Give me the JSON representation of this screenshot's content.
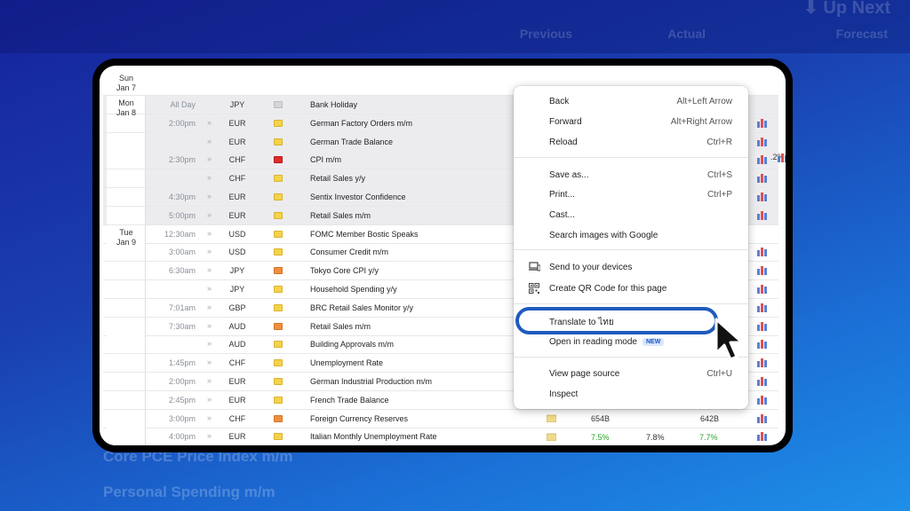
{
  "background": {
    "up_next": "⬇ Up Next",
    "col_prev": "Previous",
    "col_actual": "Actual",
    "col_forecast": "Forecast",
    "line1": "Core PCE Price Index m/m",
    "line2": "Personal Spending m/m"
  },
  "calendar": {
    "days": [
      {
        "name": "Sun",
        "date": "Jan 7"
      },
      {
        "name": "Mon",
        "date": "Jan 8"
      },
      {
        "name": "Tue",
        "date": "Jan 9"
      }
    ],
    "events": [
      {
        "time": "All Day",
        "currency": "JPY",
        "impact": "gray",
        "title": "Bank Holiday",
        "signal": false,
        "bars": false,
        "shaded": true
      },
      {
        "time": "2:00pm",
        "currency": "EUR",
        "impact": "yellow",
        "title": "German Factory Orders m/m",
        "signal": true,
        "bars": true,
        "shaded": true
      },
      {
        "time": "",
        "currency": "EUR",
        "impact": "yellow",
        "title": "German Trade Balance",
        "signal": true,
        "bars": true,
        "shaded": true
      },
      {
        "time": "2:30pm",
        "currency": "CHF",
        "impact": "red",
        "title": "CPI m/m",
        "signal": true,
        "bars": true,
        "shaded": true
      },
      {
        "time": "",
        "currency": "CHF",
        "impact": "yellow",
        "title": "Retail Sales y/y",
        "signal": true,
        "bars": true,
        "shaded": true
      },
      {
        "time": "4:30pm",
        "currency": "EUR",
        "impact": "yellow",
        "title": "Sentix Investor Confidence",
        "signal": true,
        "bars": true,
        "shaded": true
      },
      {
        "time": "5:00pm",
        "currency": "EUR",
        "impact": "yellow",
        "title": "Retail Sales m/m",
        "signal": true,
        "bars": true,
        "shaded": true
      },
      {
        "time": "12:30am",
        "currency": "USD",
        "impact": "yellow",
        "title": "FOMC Member Bostic Speaks",
        "signal": true,
        "bars": false,
        "shaded": false
      },
      {
        "time": "3:00am",
        "currency": "USD",
        "impact": "yellow",
        "title": "Consumer Credit m/m",
        "signal": true,
        "bars": true,
        "shaded": false
      },
      {
        "time": "6:30am",
        "currency": "JPY",
        "impact": "orange",
        "title": "Tokyo Core CPI y/y",
        "signal": true,
        "bars": true,
        "shaded": false
      },
      {
        "time": "",
        "currency": "JPY",
        "impact": "yellow",
        "title": "Household Spending y/y",
        "signal": true,
        "bars": true,
        "shaded": false
      },
      {
        "time": "7:01am",
        "currency": "GBP",
        "impact": "yellow",
        "title": "BRC Retail Sales Monitor y/y",
        "signal": true,
        "bars": true,
        "shaded": false
      },
      {
        "time": "7:30am",
        "currency": "AUD",
        "impact": "orange",
        "title": "Retail Sales m/m",
        "signal": true,
        "bars": true,
        "shaded": false
      },
      {
        "time": "",
        "currency": "AUD",
        "impact": "yellow",
        "title": "Building Approvals m/m",
        "signal": true,
        "bars": true,
        "shaded": false
      },
      {
        "time": "1:45pm",
        "currency": "CHF",
        "impact": "yellow",
        "title": "Unemployment Rate",
        "signal": true,
        "bars": true,
        "shaded": false
      },
      {
        "time": "2:00pm",
        "currency": "EUR",
        "impact": "yellow",
        "title": "German Industrial Production m/m",
        "signal": true,
        "bars": true,
        "shaded": false
      },
      {
        "time": "2:45pm",
        "currency": "EUR",
        "impact": "yellow",
        "title": "French Trade Balance",
        "signal": true,
        "bars": true,
        "shaded": false
      },
      {
        "time": "3:00pm",
        "currency": "CHF",
        "impact": "orange",
        "title": "Foreign Currency Reserves",
        "signal": true,
        "bars": true,
        "shaded": false
      },
      {
        "time": "4:00pm",
        "currency": "EUR",
        "impact": "yellow",
        "title": "Italian Monthly Unemployment Rate",
        "signal": true,
        "bars": true,
        "shaded": false
      }
    ],
    "cpi_previous_partial": ".2%",
    "reserves_actual": "654B",
    "reserves_previous": "642B",
    "unemp_actual": "7.5%",
    "unemp_forecast": "7.8%",
    "unemp_previous": "7.7%"
  },
  "context_menu": {
    "items": [
      {
        "label": "Back",
        "shortcut": "Alt+Left Arrow"
      },
      {
        "label": "Forward",
        "shortcut": "Alt+Right Arrow"
      },
      {
        "label": "Reload",
        "shortcut": "Ctrl+R"
      },
      {
        "label": "Save as...",
        "shortcut": "Ctrl+S"
      },
      {
        "label": "Print...",
        "shortcut": "Ctrl+P"
      },
      {
        "label": "Cast...",
        "shortcut": ""
      },
      {
        "label": "Search images with Google",
        "shortcut": ""
      },
      {
        "label": "Send to your devices",
        "shortcut": ""
      },
      {
        "label": "Create QR Code for this page",
        "shortcut": ""
      },
      {
        "label": "Translate to ไทย",
        "shortcut": ""
      },
      {
        "label": "Open in reading mode",
        "shortcut": "",
        "badge": "NEW"
      },
      {
        "label": "View page source",
        "shortcut": "Ctrl+U"
      },
      {
        "label": "Inspect",
        "shortcut": ""
      }
    ]
  },
  "colors": {
    "impact_yellow": "#f4d24a",
    "impact_orange": "#ef8f3d",
    "impact_red": "#e02a2a",
    "highlight": "#1e5bbd",
    "positive": "#2aa52a"
  }
}
